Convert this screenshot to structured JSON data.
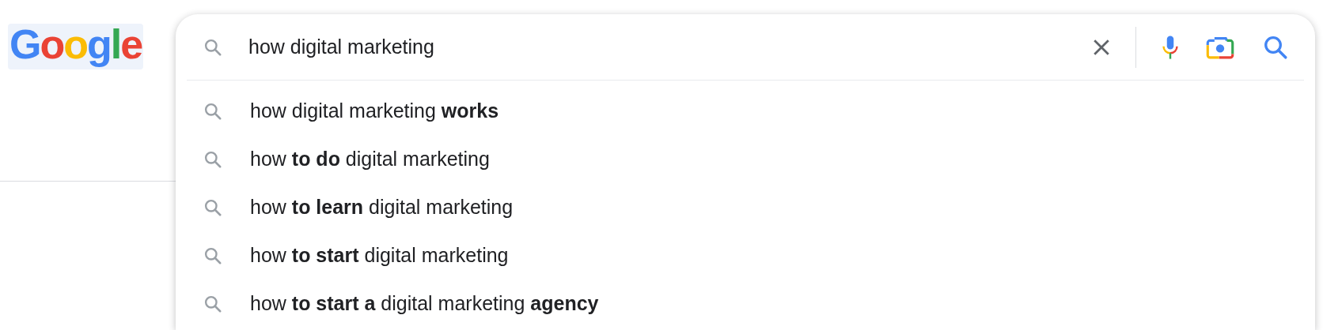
{
  "logo": {
    "text": "Google"
  },
  "search": {
    "value": "how digital marketing"
  },
  "suggestions": [
    "how digital marketing **works**",
    "how **to do** digital marketing",
    "how **to learn** digital marketing",
    "how **to start** digital marketing",
    "how **to start a** digital marketing **agency**"
  ]
}
